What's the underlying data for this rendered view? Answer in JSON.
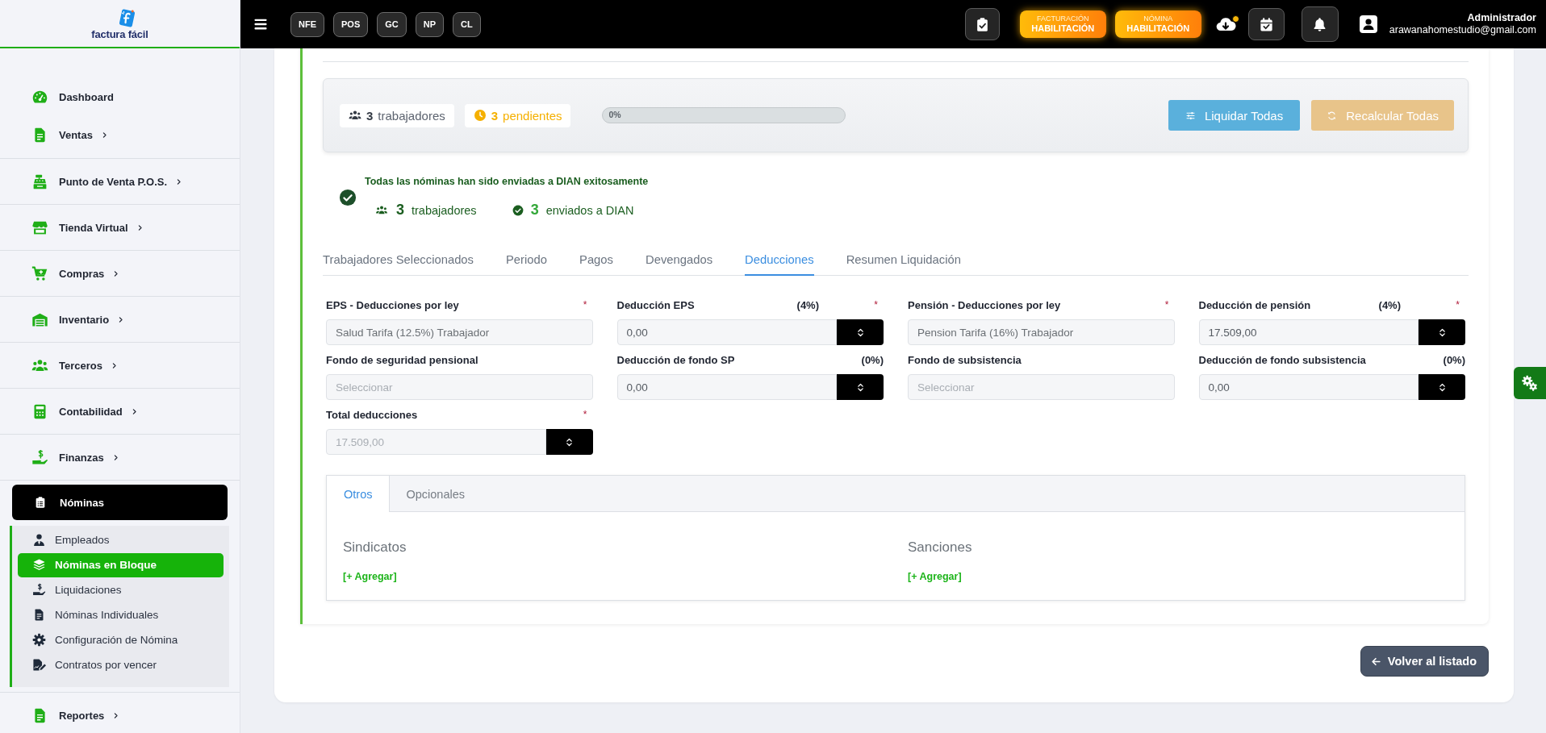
{
  "sidebar": {
    "logo": {
      "text": "factura fácil"
    },
    "items": [
      {
        "label": "Dashboard",
        "kind": "link",
        "selected": false
      },
      {
        "label": "Ventas",
        "kind": "menu",
        "selected": false
      },
      {
        "label": "Punto de Venta P.O.S.",
        "kind": "menu",
        "selected": false
      },
      {
        "label": "Tienda Virtual",
        "kind": "menu",
        "selected": false
      },
      {
        "label": "Compras",
        "kind": "menu",
        "selected": false
      },
      {
        "label": "Inventario",
        "kind": "menu",
        "selected": false
      },
      {
        "label": "Terceros",
        "kind": "menu",
        "selected": false
      },
      {
        "label": "Contabilidad",
        "kind": "menu",
        "selected": false
      },
      {
        "label": "Finanzas",
        "kind": "menu",
        "selected": false
      },
      {
        "label": "Nóminas",
        "kind": "open_menu",
        "selected": true,
        "children": [
          {
            "label": "Empleados",
            "selected": false
          },
          {
            "label": "Nóminas en Bloque",
            "selected": true
          },
          {
            "label": "Liquidaciones",
            "selected": false
          },
          {
            "label": "Nóminas Individuales",
            "selected": false
          },
          {
            "label": "Configuración de Nómina",
            "selected": false
          },
          {
            "label": "Contratos por vencer",
            "selected": false
          }
        ]
      },
      {
        "label": "Reportes",
        "kind": "menu",
        "selected": false
      }
    ]
  },
  "topbar": {
    "modules": [
      "NFE",
      "POS",
      "GC",
      "NP",
      "CL"
    ],
    "badges": [
      {
        "title": "FACTURACIÓN",
        "status": "HABILITACIÓN"
      },
      {
        "title": "NÓMINA",
        "status": "HABILITACIÓN"
      }
    ],
    "sync": {
      "notification": true
    },
    "user": {
      "name": "Administrador",
      "email": "arawanahomestudio@gmail.com"
    }
  },
  "summary": {
    "chips": [
      {
        "kind": "workers",
        "count": "3",
        "label": "trabajadores"
      },
      {
        "kind": "pending",
        "count": "3",
        "label": "pendientes"
      }
    ],
    "progress": {
      "reading": "0%"
    },
    "buttons": [
      {
        "kind": "settle",
        "label": "Liquidar Todas"
      },
      {
        "kind": "recalc",
        "label": "Recalcular Todas"
      }
    ]
  },
  "status": {
    "message": "Todas las nóminas han sido enviadas a DIAN exitosamente",
    "stats": [
      {
        "kind": "workers",
        "count": "3",
        "label": "trabajadores"
      },
      {
        "kind": "sent",
        "count": "3",
        "label": "enviados a DIAN"
      }
    ]
  },
  "tabs": [
    {
      "label": "Trabajadores Seleccionados",
      "selected": false
    },
    {
      "label": "Periodo",
      "selected": false
    },
    {
      "label": "Pagos",
      "selected": false
    },
    {
      "label": "Devengados",
      "selected": false
    },
    {
      "label": "Deducciones",
      "selected": true
    },
    {
      "label": "Resumen Liquidación",
      "selected": false
    }
  ],
  "fields": [
    {
      "kind": "select",
      "label": "EPS - Deducciones por ley",
      "required_mark": "*",
      "value": "Salud Tarifa (12.5%) Trabajador"
    },
    {
      "kind": "number",
      "label": "Deducción EPS",
      "rate": "(4%)",
      "required_mark": "*",
      "value": "0,00",
      "disabled": false
    },
    {
      "kind": "select",
      "label": "Pensión - Deducciones por ley",
      "required_mark": "*",
      "value": "Pension Tarifa (16%) Trabajador"
    },
    {
      "kind": "number",
      "label": "Deducción de pensión",
      "rate": "(4%)",
      "required_mark": "*",
      "value": "17.509,00",
      "disabled": false
    },
    {
      "kind": "select",
      "label": "Fondo de seguridad pensional",
      "placeholder": "Seleccionar"
    },
    {
      "kind": "number",
      "label": "Deducción de fondo SP",
      "rate": "(0%)",
      "value": "0,00",
      "disabled": false
    },
    {
      "kind": "select",
      "label": "Fondo de subsistencia",
      "placeholder": "Seleccionar"
    },
    {
      "kind": "number",
      "label": "Deducción de fondo subsistencia",
      "rate": "(0%)",
      "value": "0,00",
      "disabled": false
    },
    {
      "kind": "number",
      "label": "Total deducciones",
      "required_mark": "*",
      "value": "17.509,00",
      "disabled": true
    }
  ],
  "subtabs": [
    {
      "label": "Otros",
      "selected": true
    },
    {
      "label": "Opcionales",
      "selected": false
    }
  ],
  "sections": [
    {
      "title": "Sindicatos",
      "action": "[+ Agregar]"
    },
    {
      "title": "Sanciones",
      "action": "[+ Agregar]"
    }
  ],
  "back_button": "Volver al listado"
}
